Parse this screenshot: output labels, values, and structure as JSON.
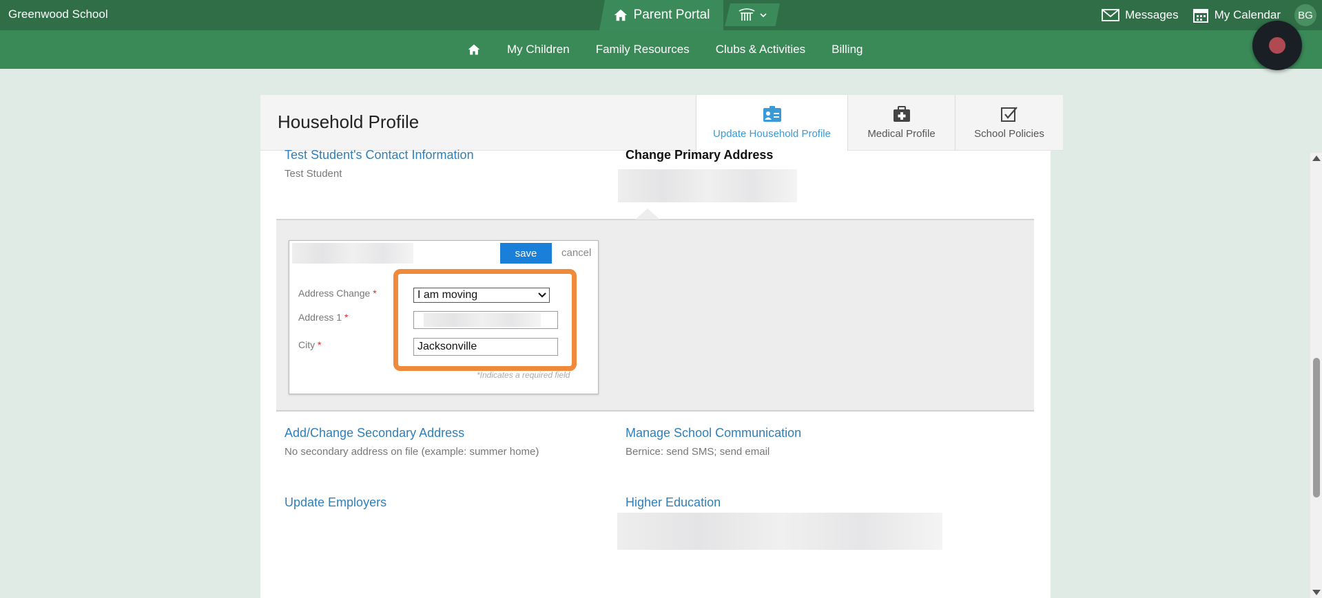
{
  "topbar": {
    "school_name": "Greenwood School",
    "portal_label": "Parent Portal",
    "messages": "Messages",
    "calendar": "My Calendar",
    "avatar_initials": "BG"
  },
  "nav": {
    "items": [
      "My Children",
      "Family Resources",
      "Clubs & Activities",
      "Billing"
    ]
  },
  "page": {
    "title": "Household Profile",
    "tabs": [
      "Update Household Profile",
      "Medical Profile",
      "School Policies"
    ],
    "active_tab": "Update Household Profile"
  },
  "sections": {
    "contact_link": "Test Student's Contact Information",
    "contact_sub": "Test Student",
    "primary_address_heading": "Change Primary Address",
    "secondary_link": "Add/Change Secondary Address",
    "secondary_sub": "No secondary address on file (example: summer home)",
    "communication_link": "Manage School Communication",
    "communication_sub": "Bernice: send SMS; send email",
    "employers_link": "Update Employers",
    "higher_ed_link": "Higher Education"
  },
  "form": {
    "save_label": "save",
    "cancel_label": "cancel",
    "address_change_label": "Address Change",
    "address_change_value": "I am moving",
    "address1_label": "Address 1",
    "address1_value": "",
    "city_label": "City",
    "city_value": "Jacksonville",
    "required_star": "*",
    "required_note": "*Indicates a required field"
  },
  "colors": {
    "topbar": "#2f6e46",
    "navbar": "#3a8a58",
    "link": "#2f7fb8",
    "save_button": "#1a7fd9",
    "highlight": "#f08a3a"
  }
}
